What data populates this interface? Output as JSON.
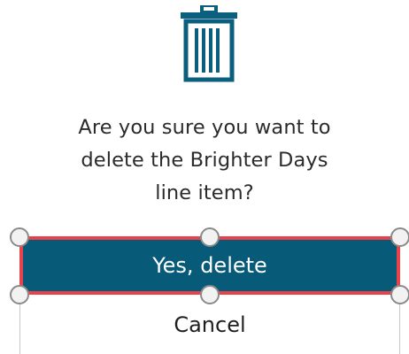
{
  "dialog": {
    "icon": "trash-icon",
    "message_lines": [
      "Are you sure you want to",
      "delete the Brighter Days",
      "line item?"
    ],
    "confirm_label": "Yes, delete",
    "cancel_label": "Cancel"
  },
  "colors": {
    "icon": "#0b5f7e",
    "confirm_background": "#075a78",
    "selection_outline": "#e8424b",
    "text": "#2b2b2b"
  }
}
